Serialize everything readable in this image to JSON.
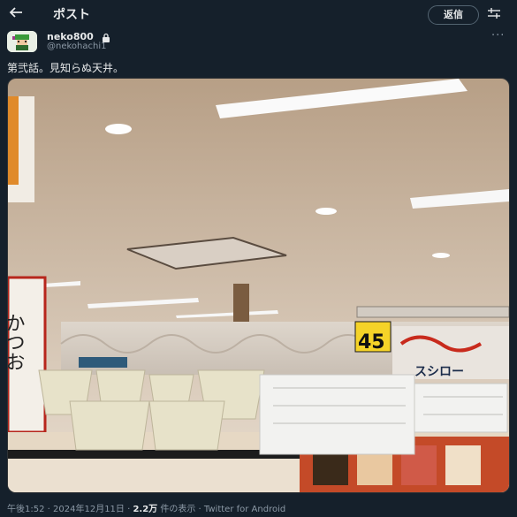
{
  "header": {
    "title": "ポスト",
    "reply_label": "返信"
  },
  "author": {
    "name": "neko800",
    "handle": "@nekohachi1"
  },
  "tweet": {
    "text": "第弐話。見知らぬ天井。"
  },
  "photo": {
    "price_sign": "45",
    "store_text": "かつお",
    "banner_text": "スシロー"
  },
  "footer": {
    "time": "午後1:52",
    "sep1": " · ",
    "date": "2024年12月11日",
    "sep2": " · ",
    "views_value": "2.2万",
    "views_label": " 件の表示",
    "sep3": " · ",
    "client": "Twitter for Android"
  },
  "colors": {
    "background": "#15202b",
    "muted": "#8b98a5",
    "accent": "#f5d328"
  }
}
